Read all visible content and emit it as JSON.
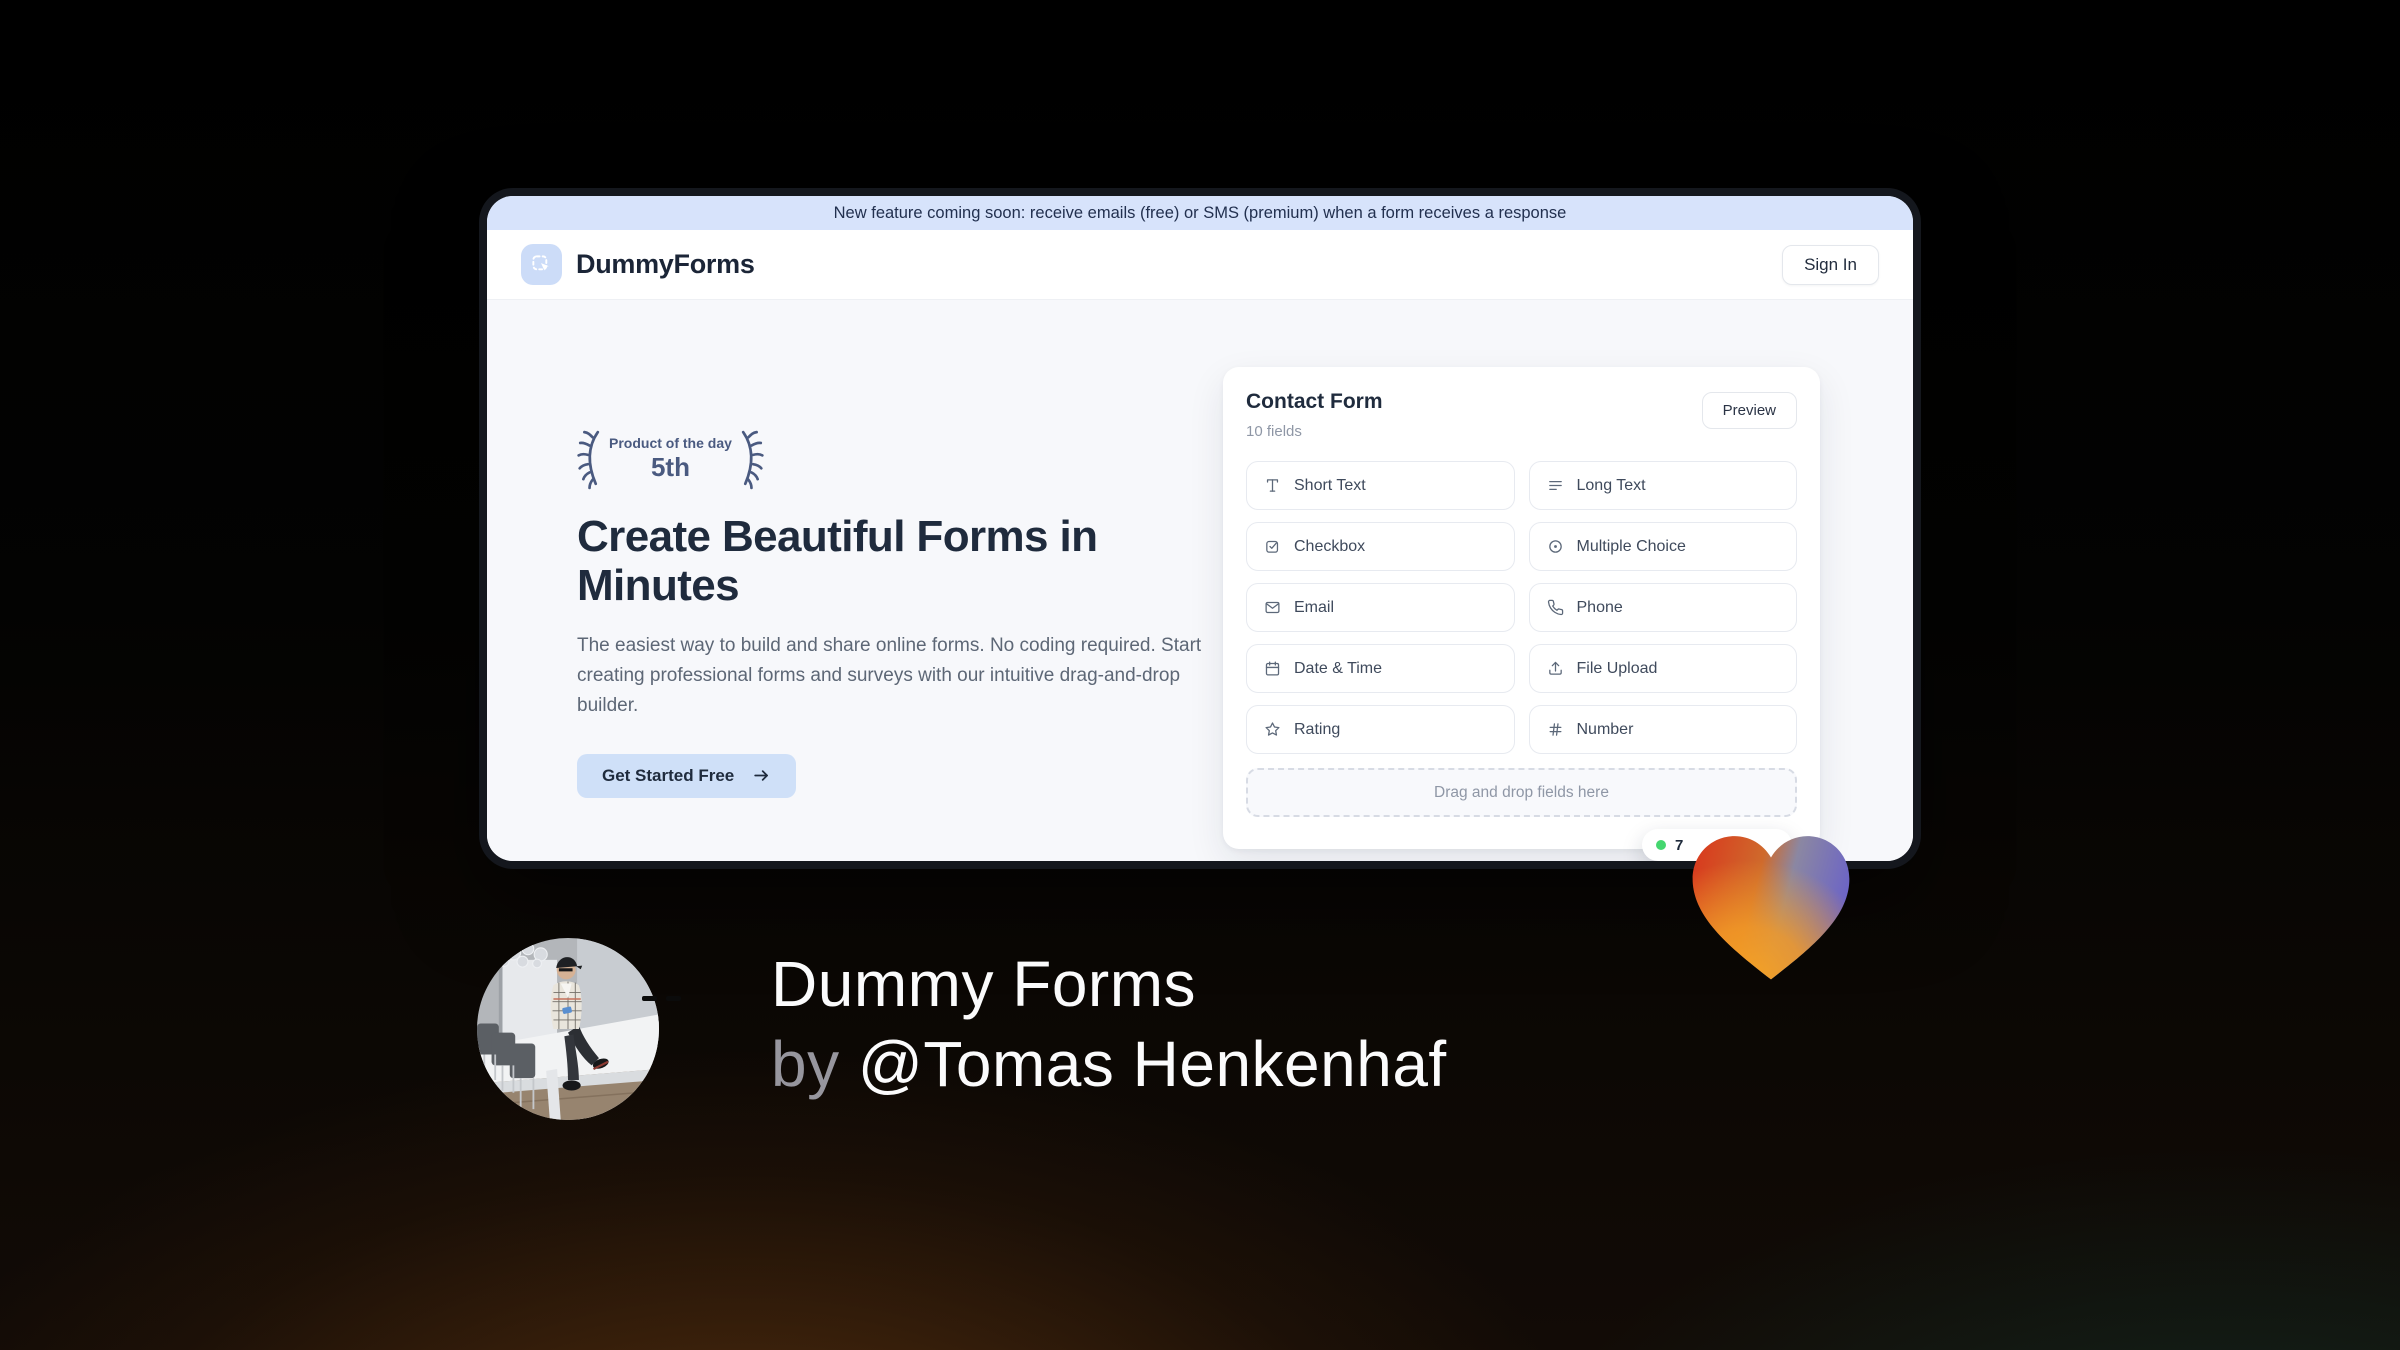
{
  "colors": {
    "banner_bg": "#d7e3fb",
    "banner_text": "#22304f",
    "logo_bg": "#ccdcf8",
    "brand_text": "#1b2537",
    "hero_bg": "#f7f8fb",
    "navy": "#1f2b3d",
    "slate_text": "#5d6776",
    "laurel": "#4a5a80",
    "accent": "#cfe0f8",
    "border": "#e7eaf0",
    "muted": "#8f97a6",
    "green_dot": "#44d66f",
    "heart_red": "#d83a1e",
    "heart_orange": "#f5a224",
    "heart_purple": "#6b63c7"
  },
  "window": {
    "banner": "New feature coming soon: receive emails (free) or SMS (premium) when a form receives a response",
    "brand": "DummyForms",
    "sign_in": "Sign In",
    "hero": {
      "award_label": "Product of the day",
      "award_rank": "5th",
      "headline": "Create Beautiful Forms in Minutes",
      "description": "The easiest way to build and share online forms. No coding required. Start creating professional forms and surveys with our intuitive drag-and-drop builder.",
      "cta": "Get Started Free"
    },
    "form_card": {
      "title": "Contact Form",
      "subtitle": "10 fields",
      "preview": "Preview",
      "fields": [
        {
          "label": "Short Text",
          "icon": "text-icon"
        },
        {
          "label": "Long Text",
          "icon": "lines-icon"
        },
        {
          "label": "Checkbox",
          "icon": "checkbox-icon"
        },
        {
          "label": "Multiple Choice",
          "icon": "radio-icon"
        },
        {
          "label": "Email",
          "icon": "envelope-icon"
        },
        {
          "label": "Phone",
          "icon": "phone-icon"
        },
        {
          "label": "Date & Time",
          "icon": "calendar-icon"
        },
        {
          "label": "File Upload",
          "icon": "upload-icon"
        },
        {
          "label": "Rating",
          "icon": "star-icon"
        },
        {
          "label": "Number",
          "icon": "hash-icon"
        }
      ],
      "dropzone": "Drag and drop fields here",
      "status_badge": "7"
    }
  },
  "caption": {
    "line1": "Dummy Forms",
    "line2_prefix": "by ",
    "line2_name": "@Tomas Henkenhaf"
  }
}
